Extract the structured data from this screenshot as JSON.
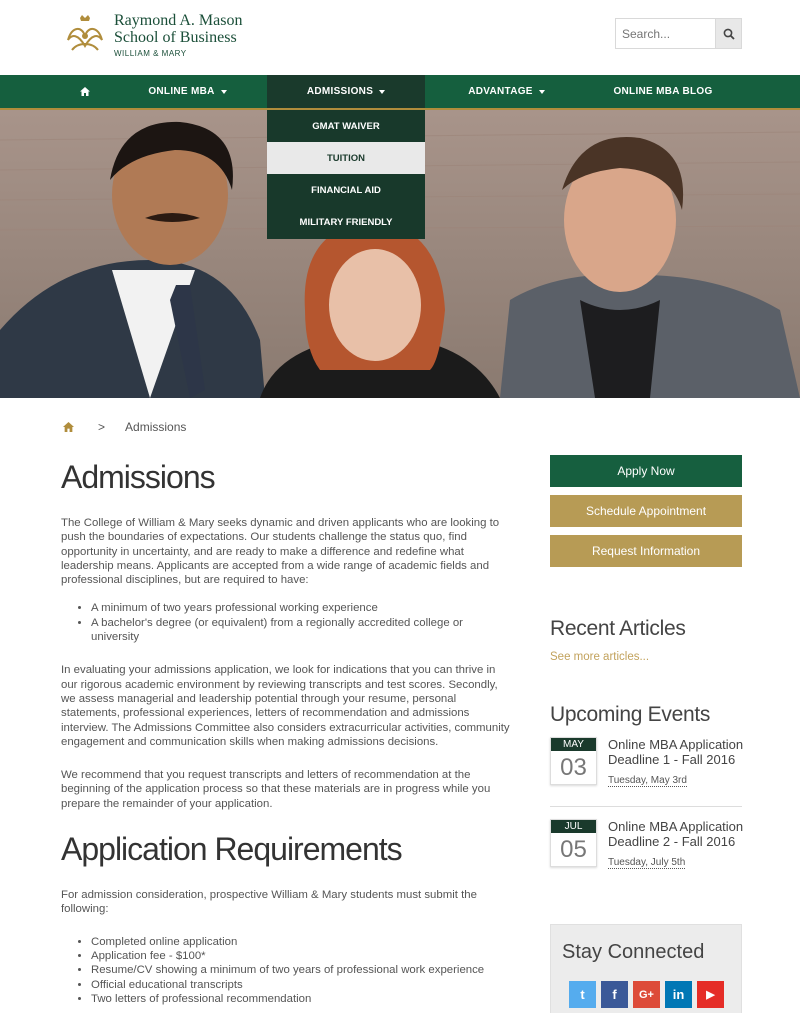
{
  "header": {
    "logo_line1": "Raymond A. Mason",
    "logo_line2": "School of Business",
    "logo_line3": "WILLIAM & MARY",
    "search_placeholder": "Search..."
  },
  "nav": {
    "home_icon": "home-icon",
    "items": [
      {
        "label": "ONLINE MBA"
      },
      {
        "label": "ADMISSIONS"
      },
      {
        "label": "ADVANTAGE"
      },
      {
        "label": "ONLINE MBA BLOG"
      }
    ]
  },
  "dropdown": {
    "items": [
      {
        "label": "GMAT WAIVER"
      },
      {
        "label": "TUITION"
      },
      {
        "label": "FINANCIAL AID"
      },
      {
        "label": "MILITARY FRIENDLY"
      }
    ]
  },
  "breadcrumb": {
    "current": "Admissions",
    "separator": ">"
  },
  "main": {
    "title": "Admissions",
    "intro": "The College of William & Mary seeks dynamic and driven applicants who are looking to push the boundaries of expectations. Our students challenge the status quo, find opportunity in uncertainty, and are ready to make a difference and redefine what leadership means. Applicants are accepted from a wide range of academic fields and professional disciplines, but are required to have:",
    "requirements": [
      "A minimum of two years professional working experience",
      "A bachelor's degree (or equivalent) from a regionally accredited college or university"
    ],
    "evaluation": "In evaluating your admissions application, we look for indications that you can thrive in our rigorous academic environment by reviewing transcripts and test scores. Secondly, we assess managerial and leadership potential through your resume, personal statements, professional experiences, letters of recommendation and admissions interview. The Admissions Committee also considers extracurricular activities, community engagement and communication skills when making admissions decisions.",
    "recommend": "We recommend that you request transcripts and letters of recommendation at the beginning of the application process so that these materials are in progress while you prepare the remainder of your application.",
    "section_title": "Application Requirements",
    "section_intro": "For admission consideration, prospective William & Mary students must submit the following:",
    "submit_list": [
      "Completed online application",
      "Application fee - $100*",
      "Resume/CV showing a minimum of two years of professional work experience",
      "Official educational transcripts",
      "Two letters of professional recommendation"
    ]
  },
  "sidebar": {
    "apply_label": "Apply Now",
    "schedule_label": "Schedule Appointment",
    "request_label": "Request Information",
    "recent_title": "Recent Articles",
    "see_more": "See more articles...",
    "events_title": "Upcoming Events",
    "events": [
      {
        "month": "MAY",
        "day": "03",
        "title": "Online MBA Application Deadline 1 - Fall 2016",
        "when": "Tuesday, May 3rd"
      },
      {
        "month": "JUL",
        "day": "05",
        "title": "Online MBA Application Deadline 2 - Fall 2016",
        "when": "Tuesday, July 5th"
      }
    ],
    "stay_title": "Stay Connected",
    "socials": [
      {
        "name": "twitter-icon",
        "glyph": "t",
        "color": "#55acee"
      },
      {
        "name": "facebook-icon",
        "glyph": "f",
        "color": "#3b5998"
      },
      {
        "name": "google-plus-icon",
        "glyph": "G+",
        "color": "#dd4b39"
      },
      {
        "name": "linkedin-icon",
        "glyph": "in",
        "color": "#0077b5"
      },
      {
        "name": "youtube-icon",
        "glyph": "▶",
        "color": "#e52d27"
      }
    ]
  },
  "colors": {
    "brand_green": "#155f3e",
    "dark_green": "#1a3a2c",
    "gold": "#b79b55"
  }
}
